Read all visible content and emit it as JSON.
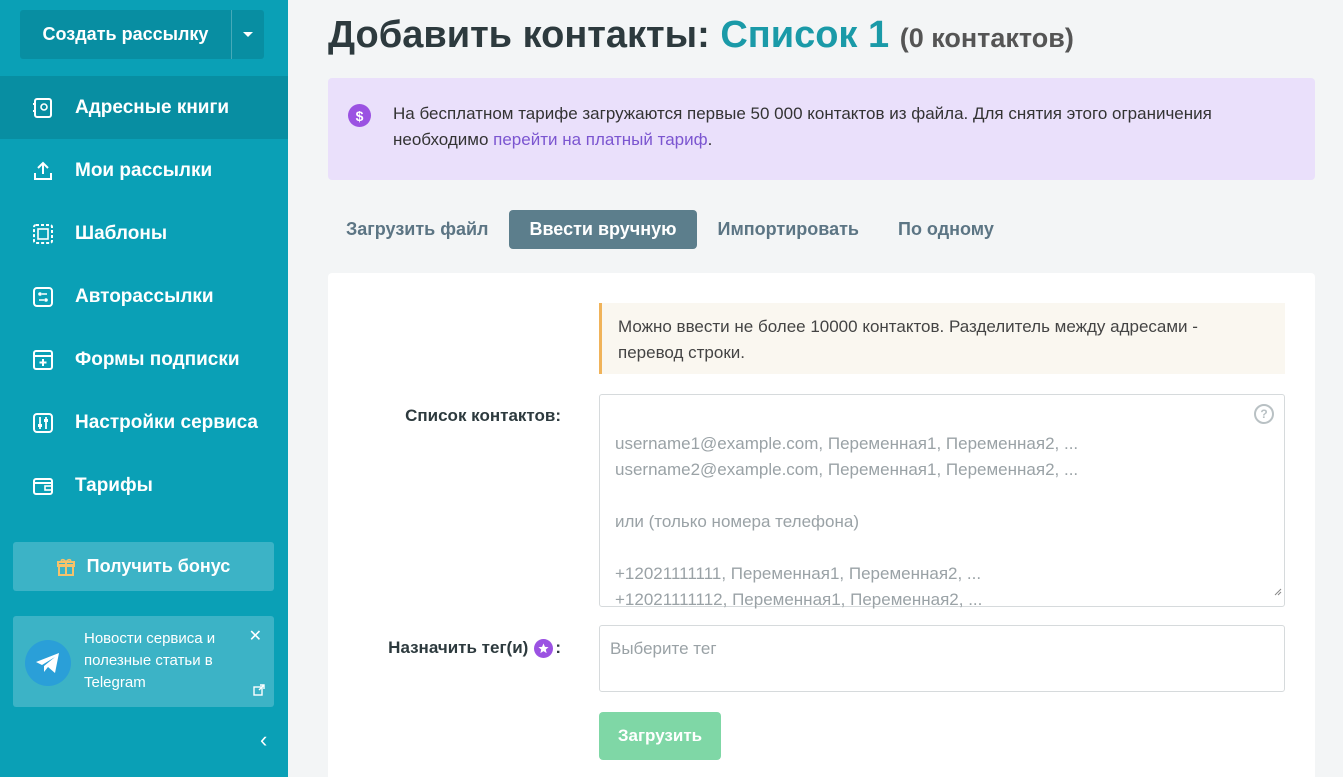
{
  "sidebar": {
    "create_label": "Создать рассылку",
    "items": [
      {
        "label": "Адресные книги",
        "icon": "address-book-icon",
        "active": true
      },
      {
        "label": "Мои рассылки",
        "icon": "send-icon",
        "active": false
      },
      {
        "label": "Шаблоны",
        "icon": "template-icon",
        "active": false
      },
      {
        "label": "Авторассылки",
        "icon": "automation-icon",
        "active": false
      },
      {
        "label": "Формы подписки",
        "icon": "form-icon",
        "active": false
      },
      {
        "label": "Настройки сервиса",
        "icon": "settings-sliders-icon",
        "active": false
      },
      {
        "label": "Тарифы",
        "icon": "wallet-icon",
        "active": false
      }
    ],
    "bonus_label": "Получить бонус",
    "telegram": {
      "text": "Новости сервиса и полезные статьи в Telegram"
    }
  },
  "page": {
    "title_prefix": "Добавить контакты:",
    "list_name": "Список 1",
    "count": "(0 контактов)"
  },
  "alert": {
    "text": "На бесплатном тарифе загружаются первые 50 000 контактов из файла. Для снятия этого ограничения необходимо ",
    "link": "перейти на платный тариф",
    "suffix": "."
  },
  "tabs": [
    {
      "label": "Загрузить файл",
      "active": false
    },
    {
      "label": "Ввести вручную",
      "active": true
    },
    {
      "label": "Импортировать",
      "active": false
    },
    {
      "label": "По одному",
      "active": false
    }
  ],
  "form": {
    "note": "Можно ввести не более 10000 контактов. Разделитель между адресами - перевод строки.",
    "contacts_label": "Список контактов:",
    "contacts_placeholder": "username1@example.com, Переменная1, Переменная2, ...\nusername2@example.com, Переменная1, Переменная2, ...\n\nили (только номера телефона)\n\n+12021111111, Переменная1, Переменная2, ...\n+12021111112, Переменная1, Переменная2, ...",
    "tags_label": "Назначить тег(и)",
    "tags_colon": ":",
    "tags_placeholder": "Выберите тег",
    "upload_label": "Загрузить"
  },
  "colors": {
    "sidebar": "#0aa0b6",
    "accent": "#1a9aa8",
    "upload_disabled": "#7fd7a6",
    "alert_bg": "#eae0fb"
  }
}
